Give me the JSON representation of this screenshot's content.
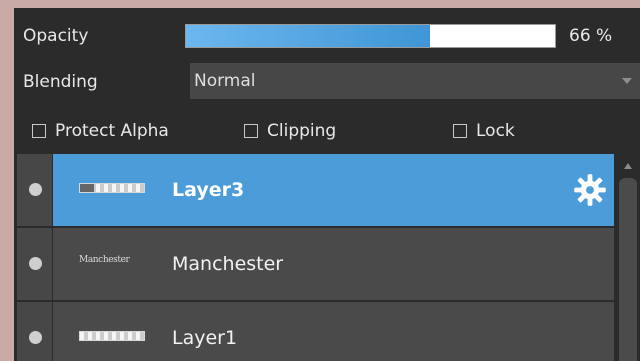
{
  "opacity": {
    "label": "Opacity",
    "value_text": "66 %",
    "fraction": 0.66
  },
  "blending": {
    "label": "Blending",
    "selected": "Normal"
  },
  "options": {
    "protect_alpha": {
      "label": "Protect Alpha",
      "checked": false
    },
    "clipping": {
      "label": "Clipping",
      "checked": false
    },
    "lock": {
      "label": "Lock",
      "checked": false
    }
  },
  "layers": [
    {
      "name": "Layer3",
      "selected": true,
      "visible": true,
      "thumb_type": "checker"
    },
    {
      "name": "Manchester",
      "selected": false,
      "visible": true,
      "thumb_type": "text",
      "thumb_text": "Manchester"
    },
    {
      "name": "Layer1",
      "selected": false,
      "visible": true,
      "thumb_type": "checker"
    }
  ],
  "icons": {
    "layer_settings": "gear-icon",
    "scroll_up": "arrow-up-icon",
    "dropdown": "chevron-down-icon"
  },
  "colors": {
    "selected": "#4b9cd9",
    "panel": "#2b2b2b",
    "row": "#4a4a4a",
    "accent_fill": "#3f95d6"
  }
}
